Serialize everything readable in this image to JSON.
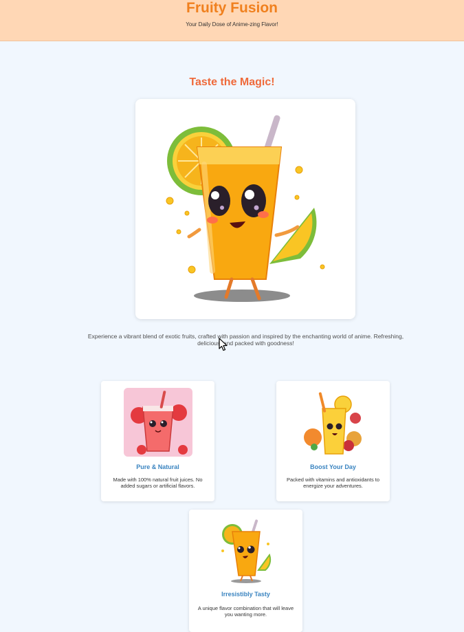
{
  "header": {
    "brand": "Fruity Fusion",
    "tagline": "Your Daily Dose of Anime-zing Flavor!"
  },
  "hero": {
    "title": "Taste the Magic!",
    "image_icon": "anime-juice-mascot-icon",
    "description": "Experience a vibrant blend of exotic fruits, crafted with passion and inspired by the enchanting world of anime. Refreshing, delicious, and packed with goodness!"
  },
  "features": [
    {
      "title": "Pure & Natural",
      "description": "Made with 100% natural fruit juices. No added sugars or artificial flavors.",
      "icon": "strawberry-drink-icon"
    },
    {
      "title": "Boost Your Day",
      "description": "Packed with vitamins and antioxidants to energize your adventures.",
      "icon": "citrus-drink-icon"
    },
    {
      "title": "Irresistibly Tasty",
      "description": "A unique flavor combination that will leave you wanting more.",
      "icon": "orange-drink-icon"
    }
  ],
  "colors": {
    "header_bg": "#ffd7b5",
    "brand": "#f0801e",
    "hero_title": "#ef6a3b",
    "feature_title": "#3a84c0",
    "page_bg": "#f1f7fe"
  }
}
